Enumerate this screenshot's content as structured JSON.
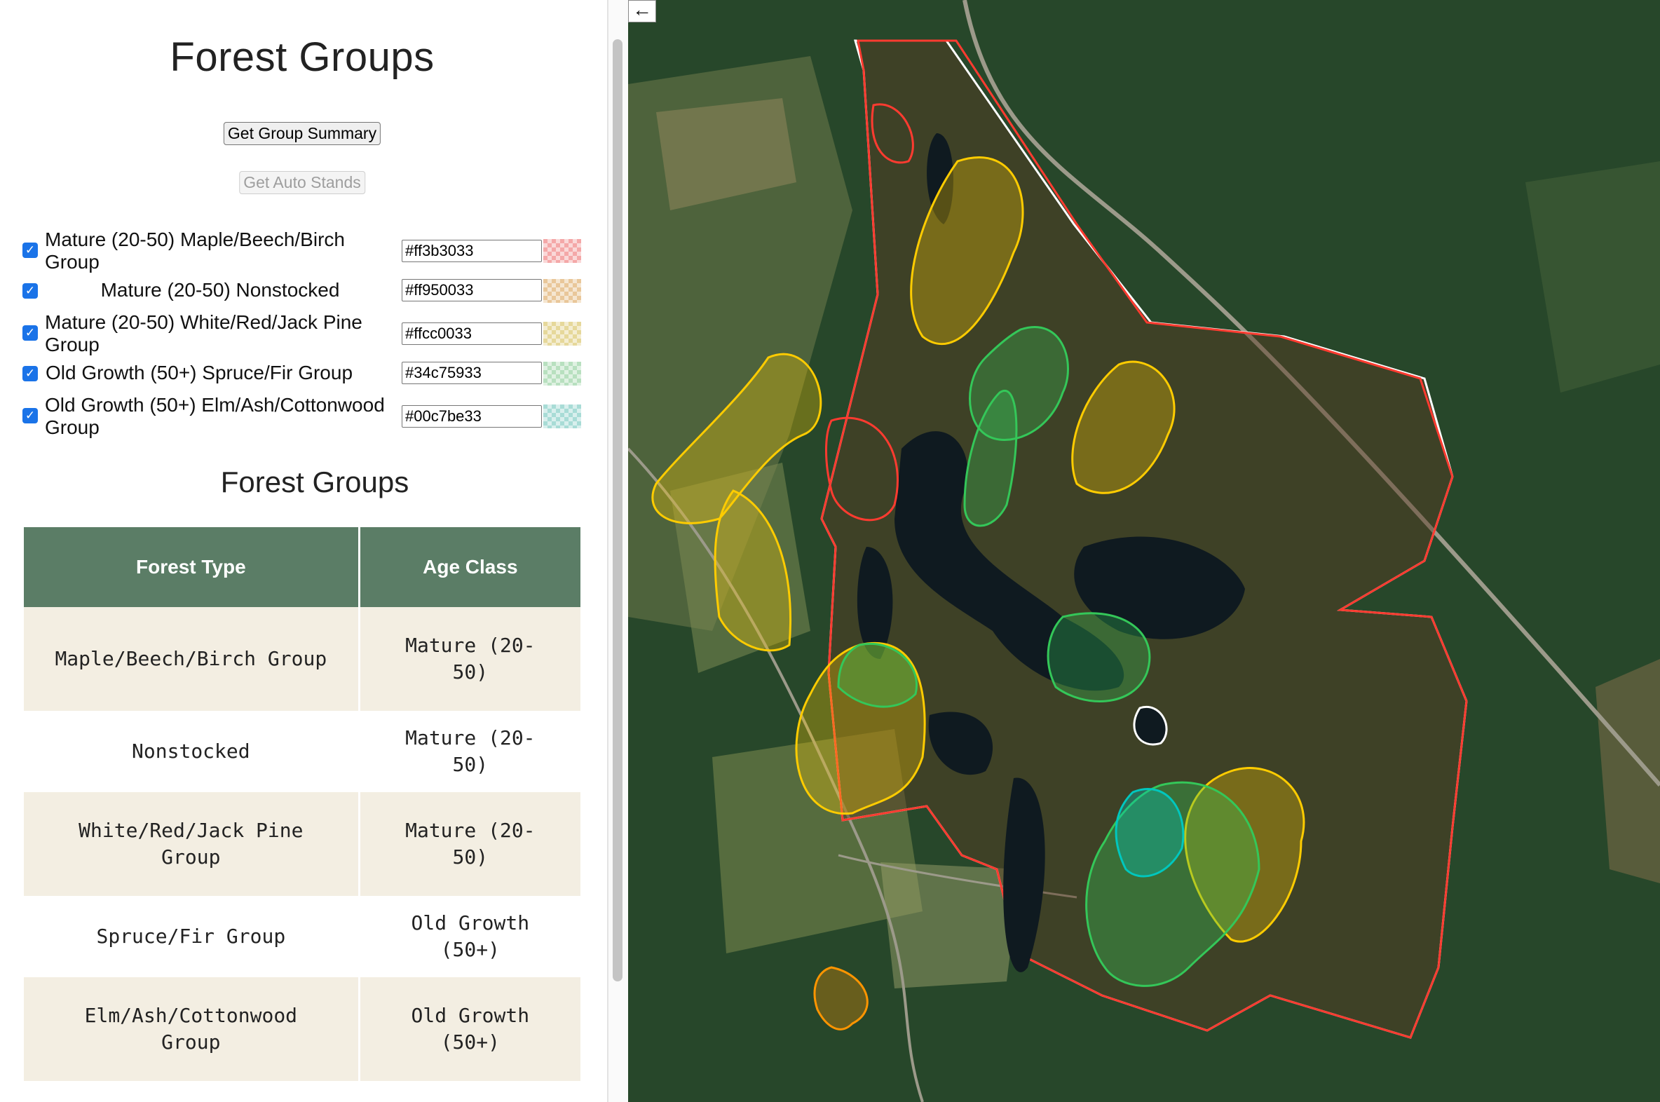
{
  "sidebar": {
    "title": "Forest Groups",
    "summary_button": "Get Group Summary",
    "auto_button": "Get Auto Stands",
    "groups": [
      {
        "label": "Mature (20-50) Maple/Beech/Birch Group",
        "color": "#ff3b3033",
        "checked": true
      },
      {
        "label": "Mature (20-50) Nonstocked",
        "color": "#ff950033",
        "checked": true
      },
      {
        "label": "Mature (20-50) White/Red/Jack Pine Group",
        "color": "#ffcc0033",
        "checked": true
      },
      {
        "label": "Old Growth (50+) Spruce/Fir Group",
        "color": "#34c75933",
        "checked": true
      },
      {
        "label": "Old Growth (50+) Elm/Ash/Cottonwood Group",
        "color": "#00c7be33",
        "checked": true
      }
    ],
    "table_title": "Forest Groups",
    "table": {
      "headers": [
        "Forest Type",
        "Age Class"
      ],
      "rows": [
        [
          "Maple/Beech/Birch Group",
          "Mature (20-50)"
        ],
        [
          "Nonstocked",
          "Mature (20-50)"
        ],
        [
          "White/Red/Jack Pine Group",
          "Mature (20-50)"
        ],
        [
          "Spruce/Fir Group",
          "Old Growth (50+)"
        ],
        [
          "Elm/Ash/Cottonwood Group",
          "Old Growth (50+)"
        ]
      ]
    }
  },
  "map": {
    "back_arrow": "←",
    "layer_colors": {
      "maple": "#ff3b30",
      "nonstocked": "#ff9500",
      "pine": "#ffcc00",
      "spruce": "#34c759",
      "elm": "#00c7be",
      "boundary": "#ffffff"
    }
  }
}
